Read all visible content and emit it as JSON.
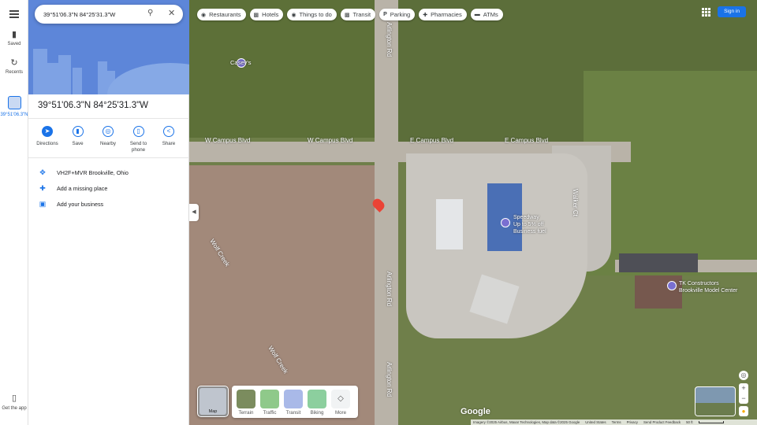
{
  "search": {
    "value": "39°51'06.3\"N 84°25'31.3\"W"
  },
  "rail": {
    "menu_icon": "menu-icon",
    "items": [
      {
        "label": "Saved",
        "icon": "bookmark-icon"
      },
      {
        "label": "Recents",
        "icon": "history-icon"
      },
      {
        "label": "39°51'06.3\"N",
        "icon": "thumbnail"
      }
    ],
    "get_app_label": "Get the app"
  },
  "panel": {
    "title": "39°51'06.3\"N 84°25'31.3\"W",
    "actions": [
      {
        "label": "Directions",
        "icon": "directions-icon"
      },
      {
        "label": "Save",
        "icon": "bookmark-icon"
      },
      {
        "label": "Nearby",
        "icon": "nearby-icon"
      },
      {
        "label": "Send to phone",
        "icon": "send-to-phone-icon"
      },
      {
        "label": "Share",
        "icon": "share-icon"
      }
    ],
    "rows": [
      {
        "text": "VH2F+MVR Brookville, Ohio",
        "icon": "plus-code-icon"
      },
      {
        "text": "Add a missing place",
        "icon": "add-place-icon"
      },
      {
        "text": "Add your business",
        "icon": "business-icon"
      }
    ]
  },
  "chips": [
    {
      "label": "Restaurants",
      "icon": "restaurant-icon"
    },
    {
      "label": "Hotels",
      "icon": "hotel-icon"
    },
    {
      "label": "Things to do",
      "icon": "camera-icon"
    },
    {
      "label": "Transit",
      "icon": "transit-icon"
    },
    {
      "label": "Parking",
      "icon": "parking-icon"
    },
    {
      "label": "Pharmacies",
      "icon": "pharmacy-icon"
    },
    {
      "label": "ATMs",
      "icon": "atm-icon"
    }
  ],
  "signin_label": "Sign in",
  "map_labels": {
    "caseys": "Casey's",
    "arlington_top": "Arlington Rd",
    "arlington_bottom": "Arlington Rd",
    "w_campus": "W Campus Blvd",
    "e_campus": "E Campus Blvd",
    "walker": "Walker Ct",
    "wolf_creek_1": "Wolf Creek",
    "wolf_creek_2": "Wolf Creek",
    "speedway_1": "Speedway",
    "speedway_2": "Up to 5% off",
    "speedway_3": "Business fuel",
    "tk_1": "TK Constructors",
    "tk_2": "Brookville Model Center"
  },
  "layers": {
    "main_label": "Map",
    "options": [
      "Terrain",
      "Traffic",
      "Transit",
      "Biking",
      "More"
    ]
  },
  "footer": {
    "imagery": "Imagery ©2025 Airbus, Maxar Technologies, Map data ©2025 Google",
    "region": "United States",
    "terms": "Terms",
    "privacy": "Privacy",
    "feedback": "Send Product Feedback",
    "scale": "50 ft"
  },
  "google_logo": "Google",
  "colors": {
    "accent": "#1a73e8",
    "pin": "#ea4335",
    "panel_hero": "#5d86d9"
  }
}
